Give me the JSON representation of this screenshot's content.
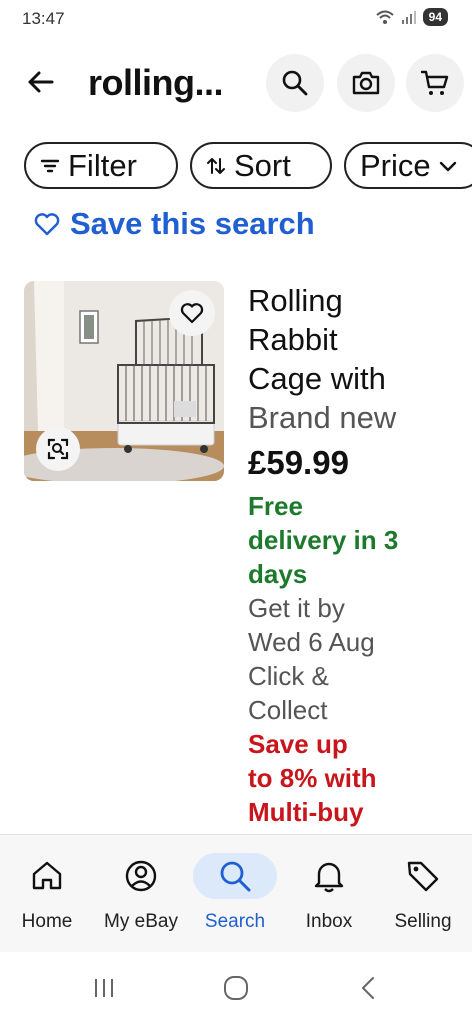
{
  "status_bar": {
    "time": "13:47",
    "battery": "94",
    "icons": [
      "wifi-icon",
      "signal-icon",
      "battery-icon"
    ]
  },
  "header": {
    "search_query": "rolling...",
    "icons": [
      "back-arrow-icon",
      "search-icon",
      "camera-icon",
      "cart-icon"
    ]
  },
  "filters": {
    "chips": [
      {
        "label": "Filter",
        "icon": "filter-icon"
      },
      {
        "label": "Sort",
        "icon": "sort-icon"
      },
      {
        "label": "Price",
        "icon": "chevron-down-icon"
      }
    ]
  },
  "save_search": {
    "label": "Save this search",
    "icon": "heart-outline-icon"
  },
  "listing": {
    "title_lines": [
      "Rolling",
      "Rabbit",
      "Cage with"
    ],
    "condition": "Brand new",
    "price": "£59.99",
    "delivery_lines": [
      "Free",
      "delivery in 3",
      "days"
    ],
    "get_it_by_lines": [
      "Get it by",
      "Wed 6 Aug"
    ],
    "click_collect_lines": [
      "Click &",
      "Collect"
    ],
    "promo_lines": [
      "Save up",
      "to 8% with",
      "Multi-buy"
    ],
    "image_icons": [
      "wishlist-heart-icon",
      "visual-search-icon"
    ]
  },
  "bottom_nav": {
    "active": "Search",
    "items": [
      {
        "label": "Home",
        "icon": "home-icon"
      },
      {
        "label": "My eBay",
        "icon": "account-icon"
      },
      {
        "label": "Search",
        "icon": "search-icon"
      },
      {
        "label": "Inbox",
        "icon": "bell-icon"
      },
      {
        "label": "Selling",
        "icon": "tag-icon"
      }
    ]
  },
  "system_nav": {
    "icons": [
      "recents-icon",
      "home-circle-icon",
      "back-chevron-icon"
    ]
  },
  "colors": {
    "link_blue": "#1f5fd1",
    "delivery_green": "#1d7a2c",
    "promo_red": "#c8161d",
    "active_nav_bg": "#dbe9fb"
  }
}
